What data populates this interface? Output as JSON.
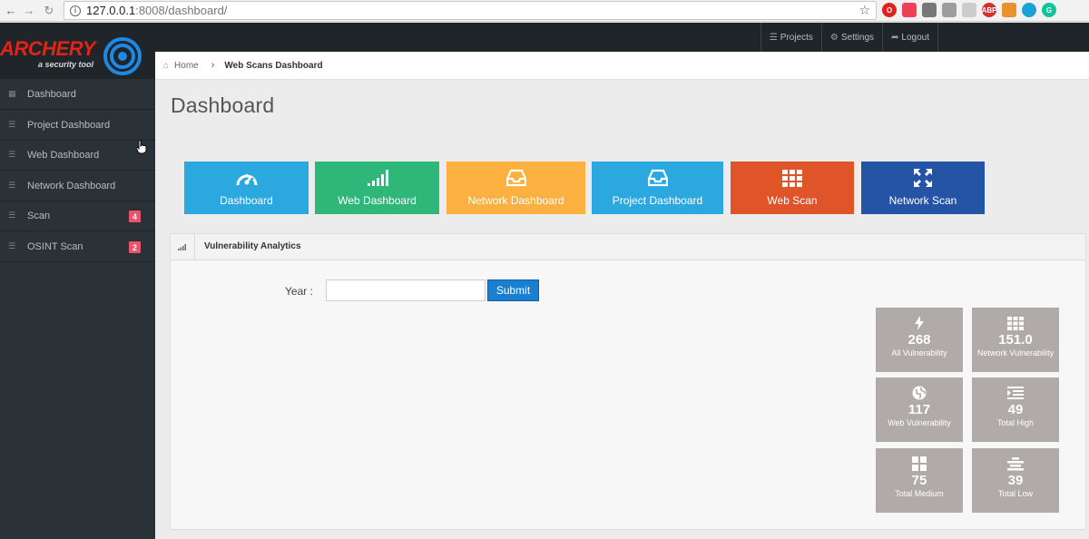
{
  "browser": {
    "url_host": "127.0.0.1",
    "url_rest": ":8008/dashboard/",
    "extensions": [
      {
        "name": "opera-icon",
        "color": "#e0211e",
        "text": "O"
      },
      {
        "name": "pocket-icon",
        "color": "#ef4056",
        "text": ""
      },
      {
        "name": "ext-square-icon",
        "color": "#777777",
        "text": ""
      },
      {
        "name": "ext-grid-icon",
        "color": "#9e9e9e",
        "text": ""
      },
      {
        "name": "shield-ext-icon",
        "color": "#cccccc",
        "text": ""
      },
      {
        "name": "adblock-icon",
        "color": "#d32f2f",
        "text": "ABP"
      },
      {
        "name": "cookie-icon",
        "color": "#e8912d",
        "text": ""
      },
      {
        "name": "gear-ext-icon",
        "color": "#1aa1d6",
        "text": ""
      },
      {
        "name": "grammarly-icon",
        "color": "#15c39a",
        "text": "G"
      }
    ]
  },
  "brand": {
    "name": "ARCHERY",
    "tagline": "a security tool",
    "color": "#e2231a",
    "target_color": "#1e88e5"
  },
  "topnav": [
    {
      "label": "Projects",
      "icon": "list-icon"
    },
    {
      "label": "Settings",
      "icon": "gear-icon"
    },
    {
      "label": "Logout",
      "icon": "logout-icon"
    }
  ],
  "sidebar": {
    "items": [
      {
        "label": "Dashboard",
        "icon": "grid-icon",
        "badge": ""
      },
      {
        "label": "Project Dashboard",
        "icon": "list-icon",
        "badge": ""
      },
      {
        "label": "Web Dashboard",
        "icon": "list-icon",
        "badge": ""
      },
      {
        "label": "Network Dashboard",
        "icon": "list-icon",
        "badge": ""
      },
      {
        "label": "Scan",
        "icon": "list-icon",
        "badge": "4"
      },
      {
        "label": "OSINT Scan",
        "icon": "list-icon",
        "badge": "2"
      }
    ]
  },
  "breadcrumb": {
    "home": "Home",
    "current": "Web Scans Dashboard"
  },
  "page": {
    "title": "Dashboard"
  },
  "tiles": [
    {
      "label": "Dashboard",
      "icon": "gauge-icon",
      "color": "#2ca8e1"
    },
    {
      "label": "Web Dashboard",
      "icon": "signal-icon",
      "color": "#2fb779"
    },
    {
      "label": "Network Dashboard",
      "icon": "inbox-icon",
      "color": "#fbb040"
    },
    {
      "label": "Project Dashboard",
      "icon": "inbox-icon",
      "color": "#2ca8e1"
    },
    {
      "label": "Web Scan",
      "icon": "th-icon",
      "color": "#e0542a"
    },
    {
      "label": "Network Scan",
      "icon": "arrows-icon",
      "color": "#2554a6"
    }
  ],
  "analytics": {
    "title": "Vulnerability Analytics",
    "year_label": "Year :",
    "year_value": "",
    "year_placeholder": "",
    "submit_label": "Submit",
    "stats": [
      {
        "value": "268",
        "label": "All Vulnerability",
        "icon": "bolt-icon"
      },
      {
        "value": "151.0",
        "label": "Network Vulnerability",
        "icon": "th-icon"
      },
      {
        "value": "117",
        "label": "Web Vulnerability",
        "icon": "globe-icon"
      },
      {
        "value": "49",
        "label": "Total High",
        "icon": "indent-icon"
      },
      {
        "value": "75",
        "label": "Total Medium",
        "icon": "grid-icon"
      },
      {
        "value": "39",
        "label": "Total Low",
        "icon": "align-center-icon"
      }
    ],
    "stat_color": "#b0aaa9"
  }
}
